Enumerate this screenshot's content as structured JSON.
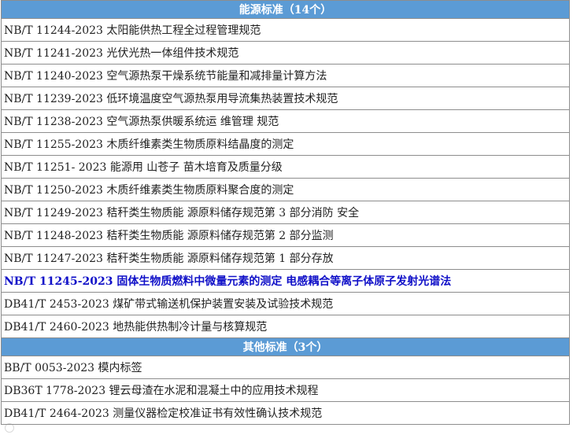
{
  "energy": {
    "header": "能源标准（14个）",
    "rows": [
      "NB/T 11244-2023 太阳能供热工程全过程管理规范",
      "NB/T 11241-2023 光伏光热一体组件技术规范",
      "NB/T 11240-2023 空气源热泵干燥系统节能量和减排量计算方法",
      "NB/T 11239-2023 低环境温度空气源热泵用导流集热装置技术规范",
      "NB/T 11238-2023 空气源热泵供暖系统运 维管理 规范",
      "NB/T 11255-2023 木质纤维素类生物质原料结晶度的测定",
      "NB/T 11251- 2023 能源用 山苍子 苗木培育及质量分级",
      "NB/T 11250-2023 木质纤维素类生物质原料聚合度的测定",
      "NB/T 11249-2023 秸秆类生物质能 源原料储存规范第  3  部分消防 安全",
      "NB/T 11248-2023 秸秆类生物质能 源原料储存规范第  2  部分监测",
      "NB/T 11247-2023 秸秆类生物质能 源原料储存规范第  1  部分存放",
      "NB/T 11245-2023 固体生物质燃料中微量元素的测定   电感耦合等离子体原子发射光谱法",
      "DB41/T 2453-2023 煤矿带式输送机保护装置安装及试验技术规范",
      "DB41/T 2460-2023 地热能供热制冷计量与核算规范"
    ]
  },
  "other": {
    "header": "其他标准（3个）",
    "rows": [
      "BB/T 0053-2023 模内标签",
      "DB36T  1778-2023 锂云母渣在水泥和混凝土中的应用技术规程",
      "DB41/T 2464-2023 测量仪器检定校准证书有效性确认技术规范"
    ]
  },
  "highlight_color": "#1010c8",
  "header_color": "#5b9bd5"
}
